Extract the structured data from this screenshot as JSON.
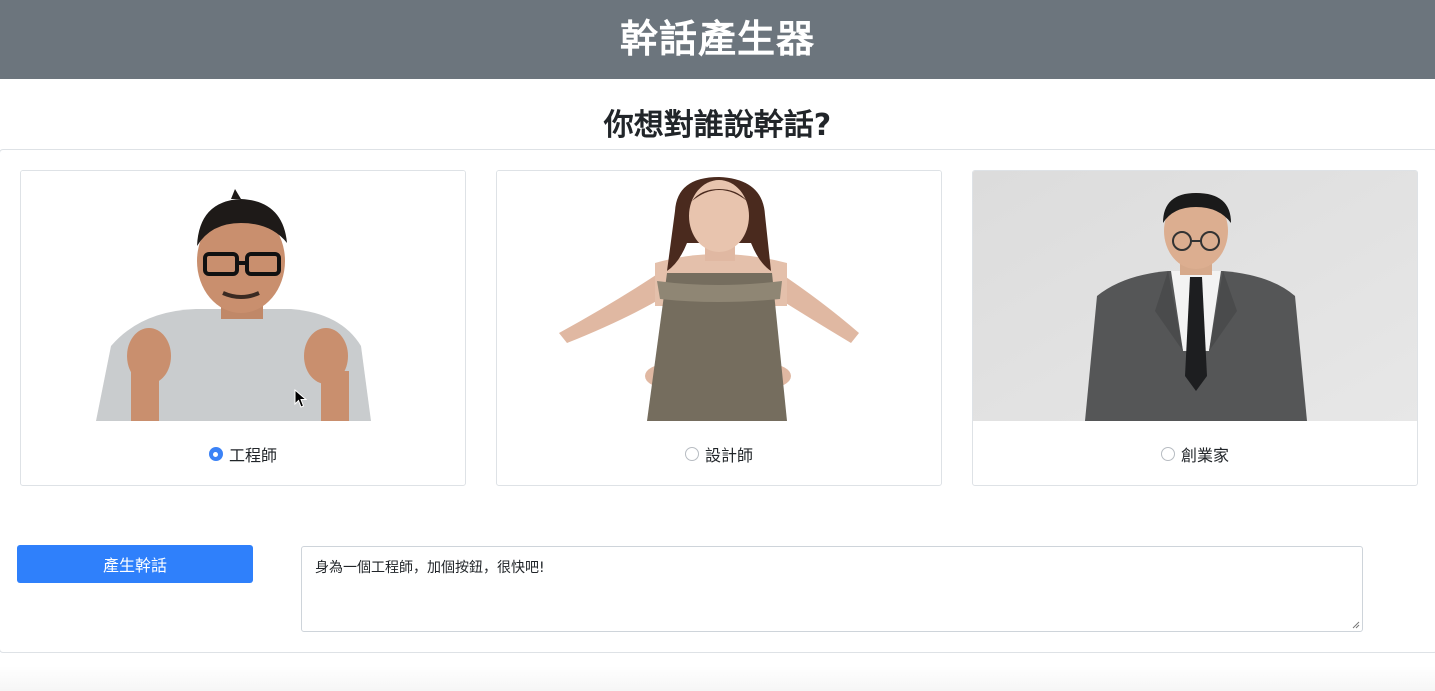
{
  "header": {
    "title": "幹話產生器"
  },
  "question": "你想對誰說幹話?",
  "options": [
    {
      "label": "工程師",
      "selected": true,
      "photo_icon": "engineer-photo"
    },
    {
      "label": "設計師",
      "selected": false,
      "photo_icon": "designer-photo"
    },
    {
      "label": "創業家",
      "selected": false,
      "photo_icon": "founder-photo"
    }
  ],
  "generate_button": {
    "label": "產生幹話"
  },
  "output": {
    "value": "身為一個工程師，加個按鈕，很快吧!"
  },
  "colors": {
    "header_bg": "#6c757d",
    "button_bg": "#2f80fb",
    "radio_checked": "#3b82f6"
  }
}
